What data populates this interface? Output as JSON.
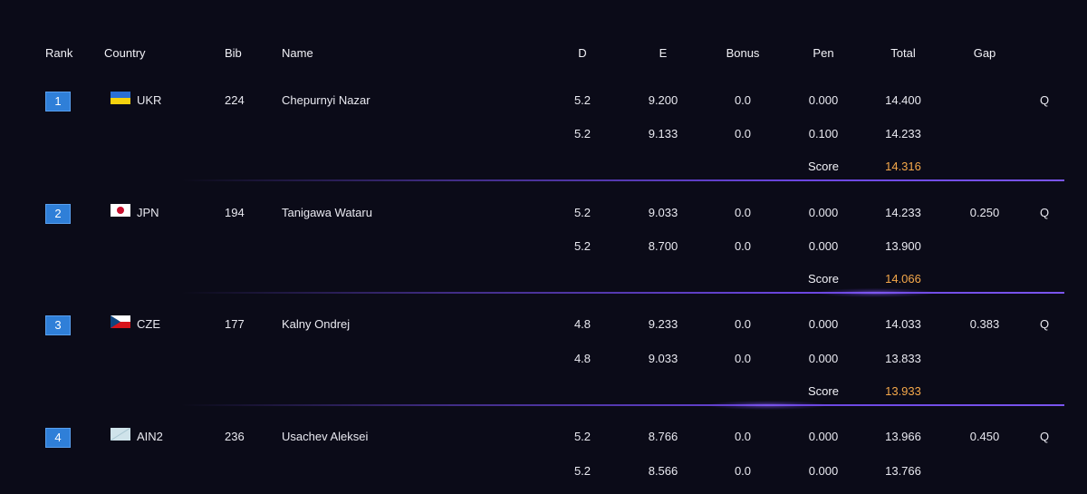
{
  "headers": {
    "rank": "Rank",
    "country": "Country",
    "bib": "Bib",
    "name": "Name",
    "d": "D",
    "e": "E",
    "bonus": "Bonus",
    "pen": "Pen",
    "total": "Total",
    "gap": "Gap"
  },
  "score_label": "Score",
  "colors": {
    "background": "#0b0b18",
    "rank_box": "#2f7fd8",
    "score_value": "#f5a84a",
    "separator": "#6b46e0"
  },
  "athletes": [
    {
      "rank": "1",
      "flag_icon": "ukraine-flag-icon",
      "country": "UKR",
      "bib": "224",
      "name": "Chepurnyi Nazar",
      "d": "5.2",
      "e": "9.200",
      "bonus": "0.0",
      "pen": "0.000",
      "total": "14.400",
      "gap": "",
      "q": "Q",
      "d2": "5.2",
      "e2": "9.133",
      "bonus2": "0.0",
      "pen2": "0.100",
      "total2": "14.233",
      "score": "14.316"
    },
    {
      "rank": "2",
      "flag_icon": "japan-flag-icon",
      "country": "JPN",
      "bib": "194",
      "name": "Tanigawa Wataru",
      "d": "5.2",
      "e": "9.033",
      "bonus": "0.0",
      "pen": "0.000",
      "total": "14.233",
      "gap": "0.250",
      "q": "Q",
      "d2": "5.2",
      "e2": "8.700",
      "bonus2": "0.0",
      "pen2": "0.000",
      "total2": "13.900",
      "score": "14.066"
    },
    {
      "rank": "3",
      "flag_icon": "czechia-flag-icon",
      "country": "CZE",
      "bib": "177",
      "name": "Kalny Ondrej",
      "d": "4.8",
      "e": "9.233",
      "bonus": "0.0",
      "pen": "0.000",
      "total": "14.033",
      "gap": "0.383",
      "q": "Q",
      "d2": "4.8",
      "e2": "9.033",
      "bonus2": "0.0",
      "pen2": "0.000",
      "total2": "13.833",
      "score": "13.933"
    },
    {
      "rank": "4",
      "flag_icon": "ain-flag-icon",
      "country": "AIN2",
      "bib": "236",
      "name": "Usachev Aleksei",
      "d": "5.2",
      "e": "8.766",
      "bonus": "0.0",
      "pen": "0.000",
      "total": "13.966",
      "gap": "0.450",
      "q": "Q",
      "d2": "5.2",
      "e2": "8.566",
      "bonus2": "0.0",
      "pen2": "0.000",
      "total2": "13.766",
      "score": ""
    }
  ]
}
